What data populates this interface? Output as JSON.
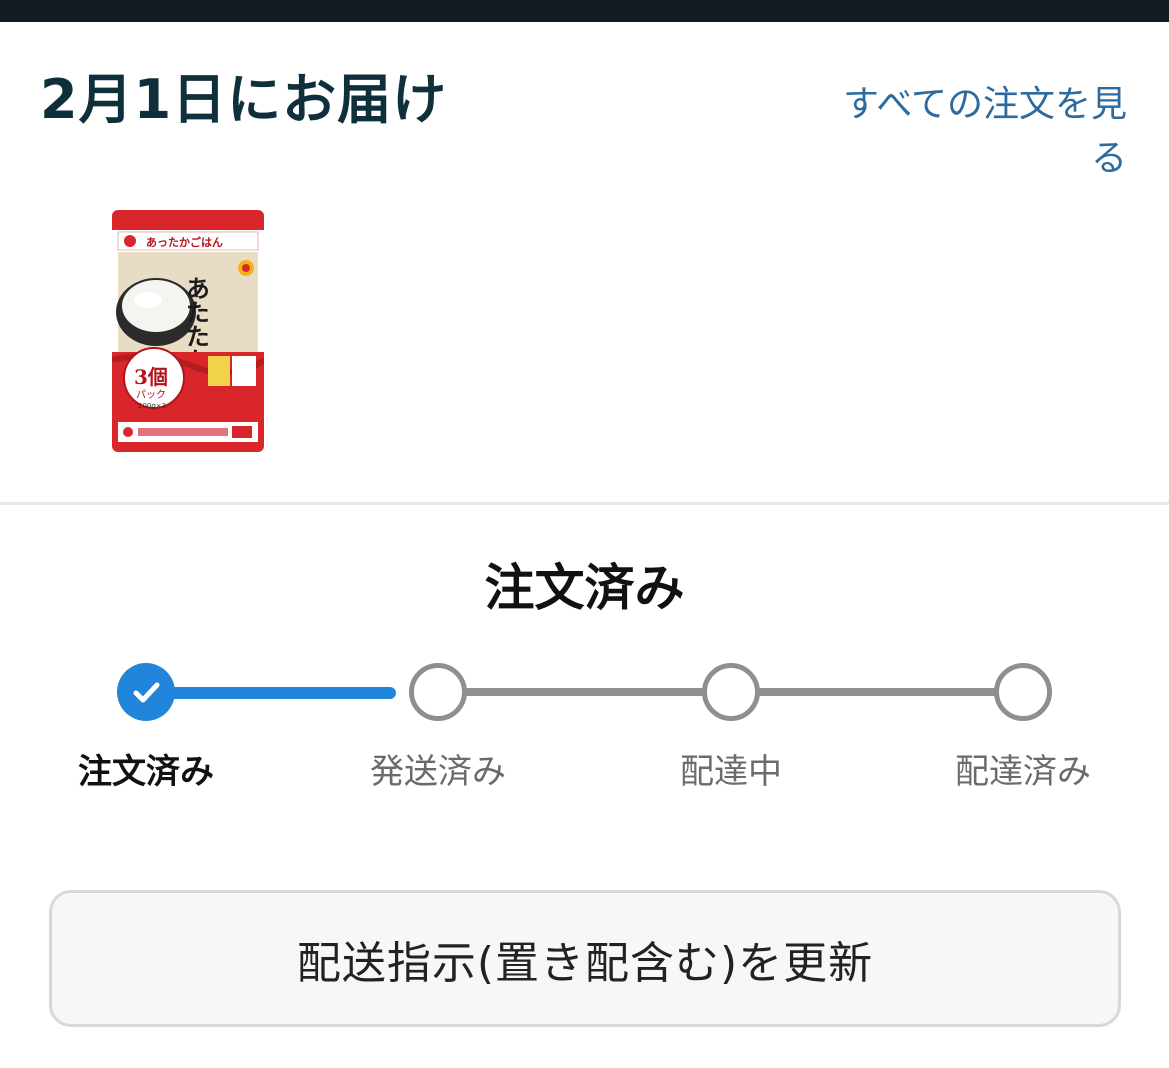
{
  "delivery": {
    "title": "2月1日にお届け",
    "view_all_link": "すべての注文を見る"
  },
  "product": {
    "brand_line": "あったかごはん",
    "name": "あたたかごはん",
    "pack_count": "3個",
    "pack_word": "パック",
    "weight": "200g×3"
  },
  "status": {
    "current": "注文済み",
    "steps": [
      {
        "label": "注文済み",
        "state": "done"
      },
      {
        "label": "発送済み",
        "state": "pending"
      },
      {
        "label": "配達中",
        "state": "pending"
      },
      {
        "label": "配達済み",
        "state": "pending"
      }
    ]
  },
  "actions": {
    "update_delivery_label": "配送指示(置き配含む)を更新"
  },
  "colors": {
    "topbar": "#131a22",
    "title": "#0f2f3a",
    "link": "#2d6a9f",
    "progress_active": "#2185dc",
    "progress_inactive": "#8f8f8f",
    "product_red": "#d8262b"
  },
  "icons": {
    "step_done": "checkmark-icon"
  }
}
